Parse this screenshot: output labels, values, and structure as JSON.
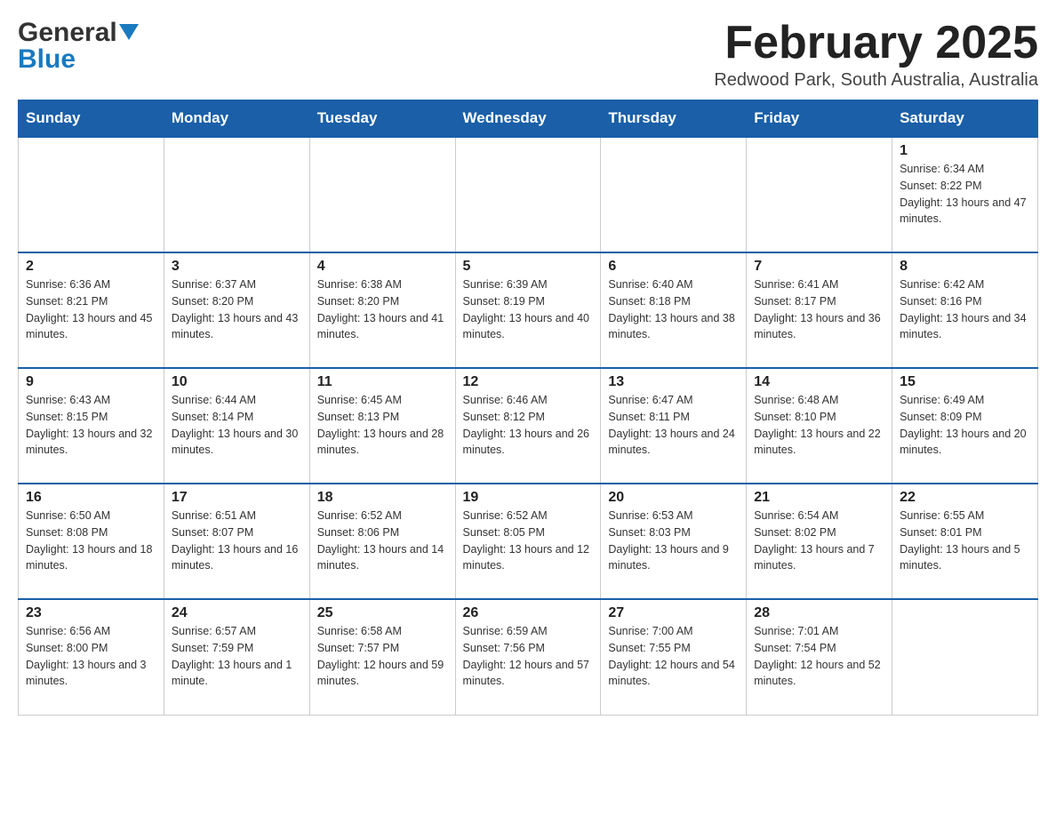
{
  "header": {
    "logo": {
      "general": "General",
      "blue": "Blue"
    },
    "title": "February 2025",
    "location": "Redwood Park, South Australia, Australia"
  },
  "calendar": {
    "days_of_week": [
      "Sunday",
      "Monday",
      "Tuesday",
      "Wednesday",
      "Thursday",
      "Friday",
      "Saturday"
    ],
    "weeks": [
      [
        {
          "day": "",
          "info": ""
        },
        {
          "day": "",
          "info": ""
        },
        {
          "day": "",
          "info": ""
        },
        {
          "day": "",
          "info": ""
        },
        {
          "day": "",
          "info": ""
        },
        {
          "day": "",
          "info": ""
        },
        {
          "day": "1",
          "info": "Sunrise: 6:34 AM\nSunset: 8:22 PM\nDaylight: 13 hours and 47 minutes."
        }
      ],
      [
        {
          "day": "2",
          "info": "Sunrise: 6:36 AM\nSunset: 8:21 PM\nDaylight: 13 hours and 45 minutes."
        },
        {
          "day": "3",
          "info": "Sunrise: 6:37 AM\nSunset: 8:20 PM\nDaylight: 13 hours and 43 minutes."
        },
        {
          "day": "4",
          "info": "Sunrise: 6:38 AM\nSunset: 8:20 PM\nDaylight: 13 hours and 41 minutes."
        },
        {
          "day": "5",
          "info": "Sunrise: 6:39 AM\nSunset: 8:19 PM\nDaylight: 13 hours and 40 minutes."
        },
        {
          "day": "6",
          "info": "Sunrise: 6:40 AM\nSunset: 8:18 PM\nDaylight: 13 hours and 38 minutes."
        },
        {
          "day": "7",
          "info": "Sunrise: 6:41 AM\nSunset: 8:17 PM\nDaylight: 13 hours and 36 minutes."
        },
        {
          "day": "8",
          "info": "Sunrise: 6:42 AM\nSunset: 8:16 PM\nDaylight: 13 hours and 34 minutes."
        }
      ],
      [
        {
          "day": "9",
          "info": "Sunrise: 6:43 AM\nSunset: 8:15 PM\nDaylight: 13 hours and 32 minutes."
        },
        {
          "day": "10",
          "info": "Sunrise: 6:44 AM\nSunset: 8:14 PM\nDaylight: 13 hours and 30 minutes."
        },
        {
          "day": "11",
          "info": "Sunrise: 6:45 AM\nSunset: 8:13 PM\nDaylight: 13 hours and 28 minutes."
        },
        {
          "day": "12",
          "info": "Sunrise: 6:46 AM\nSunset: 8:12 PM\nDaylight: 13 hours and 26 minutes."
        },
        {
          "day": "13",
          "info": "Sunrise: 6:47 AM\nSunset: 8:11 PM\nDaylight: 13 hours and 24 minutes."
        },
        {
          "day": "14",
          "info": "Sunrise: 6:48 AM\nSunset: 8:10 PM\nDaylight: 13 hours and 22 minutes."
        },
        {
          "day": "15",
          "info": "Sunrise: 6:49 AM\nSunset: 8:09 PM\nDaylight: 13 hours and 20 minutes."
        }
      ],
      [
        {
          "day": "16",
          "info": "Sunrise: 6:50 AM\nSunset: 8:08 PM\nDaylight: 13 hours and 18 minutes."
        },
        {
          "day": "17",
          "info": "Sunrise: 6:51 AM\nSunset: 8:07 PM\nDaylight: 13 hours and 16 minutes."
        },
        {
          "day": "18",
          "info": "Sunrise: 6:52 AM\nSunset: 8:06 PM\nDaylight: 13 hours and 14 minutes."
        },
        {
          "day": "19",
          "info": "Sunrise: 6:52 AM\nSunset: 8:05 PM\nDaylight: 13 hours and 12 minutes."
        },
        {
          "day": "20",
          "info": "Sunrise: 6:53 AM\nSunset: 8:03 PM\nDaylight: 13 hours and 9 minutes."
        },
        {
          "day": "21",
          "info": "Sunrise: 6:54 AM\nSunset: 8:02 PM\nDaylight: 13 hours and 7 minutes."
        },
        {
          "day": "22",
          "info": "Sunrise: 6:55 AM\nSunset: 8:01 PM\nDaylight: 13 hours and 5 minutes."
        }
      ],
      [
        {
          "day": "23",
          "info": "Sunrise: 6:56 AM\nSunset: 8:00 PM\nDaylight: 13 hours and 3 minutes."
        },
        {
          "day": "24",
          "info": "Sunrise: 6:57 AM\nSunset: 7:59 PM\nDaylight: 13 hours and 1 minute."
        },
        {
          "day": "25",
          "info": "Sunrise: 6:58 AM\nSunset: 7:57 PM\nDaylight: 12 hours and 59 minutes."
        },
        {
          "day": "26",
          "info": "Sunrise: 6:59 AM\nSunset: 7:56 PM\nDaylight: 12 hours and 57 minutes."
        },
        {
          "day": "27",
          "info": "Sunrise: 7:00 AM\nSunset: 7:55 PM\nDaylight: 12 hours and 54 minutes."
        },
        {
          "day": "28",
          "info": "Sunrise: 7:01 AM\nSunset: 7:54 PM\nDaylight: 12 hours and 52 minutes."
        },
        {
          "day": "",
          "info": ""
        }
      ]
    ]
  }
}
